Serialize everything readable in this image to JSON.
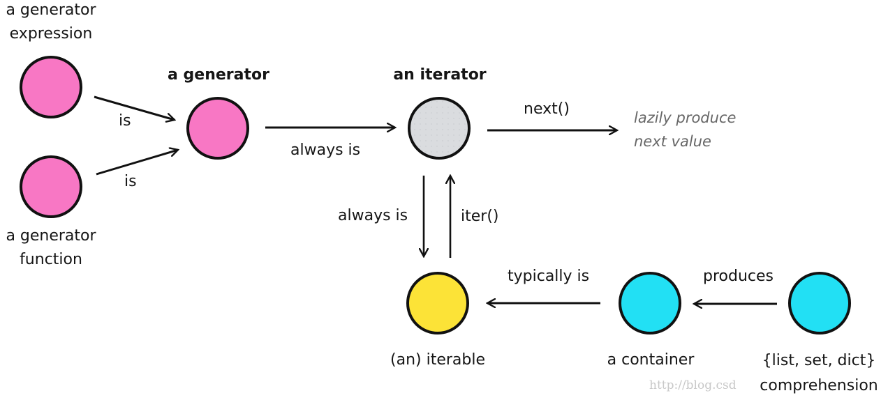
{
  "colors": {
    "generator": "#f877c4",
    "iterator": "#dadcdf",
    "iterable": "#fce337",
    "container": "#22e0f4",
    "outline": "#111111",
    "note_text": "#666666"
  },
  "nodes": {
    "gen_expression": {
      "label_line1": "a generator",
      "label_line2": "expression"
    },
    "gen_function": {
      "label_line1": "a generator",
      "label_line2": "function"
    },
    "generator": {
      "label": "a generator"
    },
    "iterator": {
      "label": "an iterator"
    },
    "iterable": {
      "label": "(an) iterable"
    },
    "container": {
      "label": "a container"
    },
    "comprehension": {
      "label_line1": "{list, set, dict}",
      "label_line2": "comprehension"
    }
  },
  "edges": {
    "expr_to_gen": "is",
    "func_to_gen": "is",
    "gen_to_iter": "always is",
    "iter_next": "next()",
    "iter_to_iterable": "always is",
    "iterable_to_iter": "iter()",
    "container_to_iterable": "typically is",
    "comp_to_container": "produces"
  },
  "note": {
    "line1": "lazily produce",
    "line2": "next value"
  },
  "watermark": "http://blog.csd"
}
